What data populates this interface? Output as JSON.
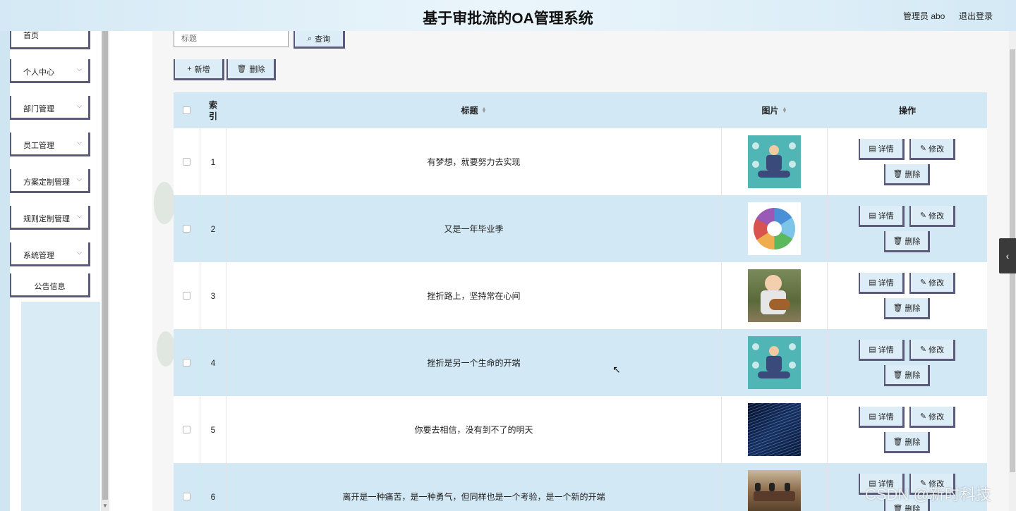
{
  "header": {
    "title": "基于审批流的OA管理系统",
    "user": "管理员 abo",
    "logout": "退出登录"
  },
  "sidebar": {
    "items": [
      {
        "label": "首页",
        "has_arrow": false
      },
      {
        "label": "个人中心",
        "has_arrow": true
      },
      {
        "label": "部门管理",
        "has_arrow": true
      },
      {
        "label": "员工管理",
        "has_arrow": true
      },
      {
        "label": "方案定制管理",
        "has_arrow": true
      },
      {
        "label": "规则定制管理",
        "has_arrow": true
      },
      {
        "label": "系统管理",
        "has_arrow": true
      },
      {
        "label": "公告信息",
        "has_arrow": false
      }
    ],
    "chevron": "⌵"
  },
  "search": {
    "placeholder": "标题",
    "button": "查询"
  },
  "toolbar": {
    "add": "新增",
    "delete": "删除"
  },
  "table": {
    "headers": {
      "index": "索引",
      "title": "标题",
      "image": "图片",
      "actions": "操作"
    },
    "rows": [
      {
        "index": "1",
        "title": "有梦想，就要努力去实现",
        "image": "meditation-illustration"
      },
      {
        "index": "2",
        "title": "又是一年毕业季",
        "image": "tech-circle-diagram"
      },
      {
        "index": "3",
        "title": "挫折路上，坚持常在心间",
        "image": "baby-with-guitar-photo"
      },
      {
        "index": "4",
        "title": "挫折是另一个生命的开端",
        "image": "meditation-illustration"
      },
      {
        "index": "5",
        "title": "你要去相信，没有到不了的明天",
        "image": "code-screen-photo"
      },
      {
        "index": "6",
        "title": "离开是一种痛苦，是一种勇气，但同样也是一个考验，是一个新的开端",
        "image": "meeting-room-photo"
      }
    ],
    "actions": {
      "detail": "详情",
      "edit": "修改",
      "delete": "删除"
    }
  },
  "watermark": "CSDN @新时科技",
  "colors": {
    "header_bg": "#d4e9f5",
    "row_blue": "#d2e8f5",
    "button_bg": "#dcedf7",
    "button_border": "#5c5a7a"
  }
}
